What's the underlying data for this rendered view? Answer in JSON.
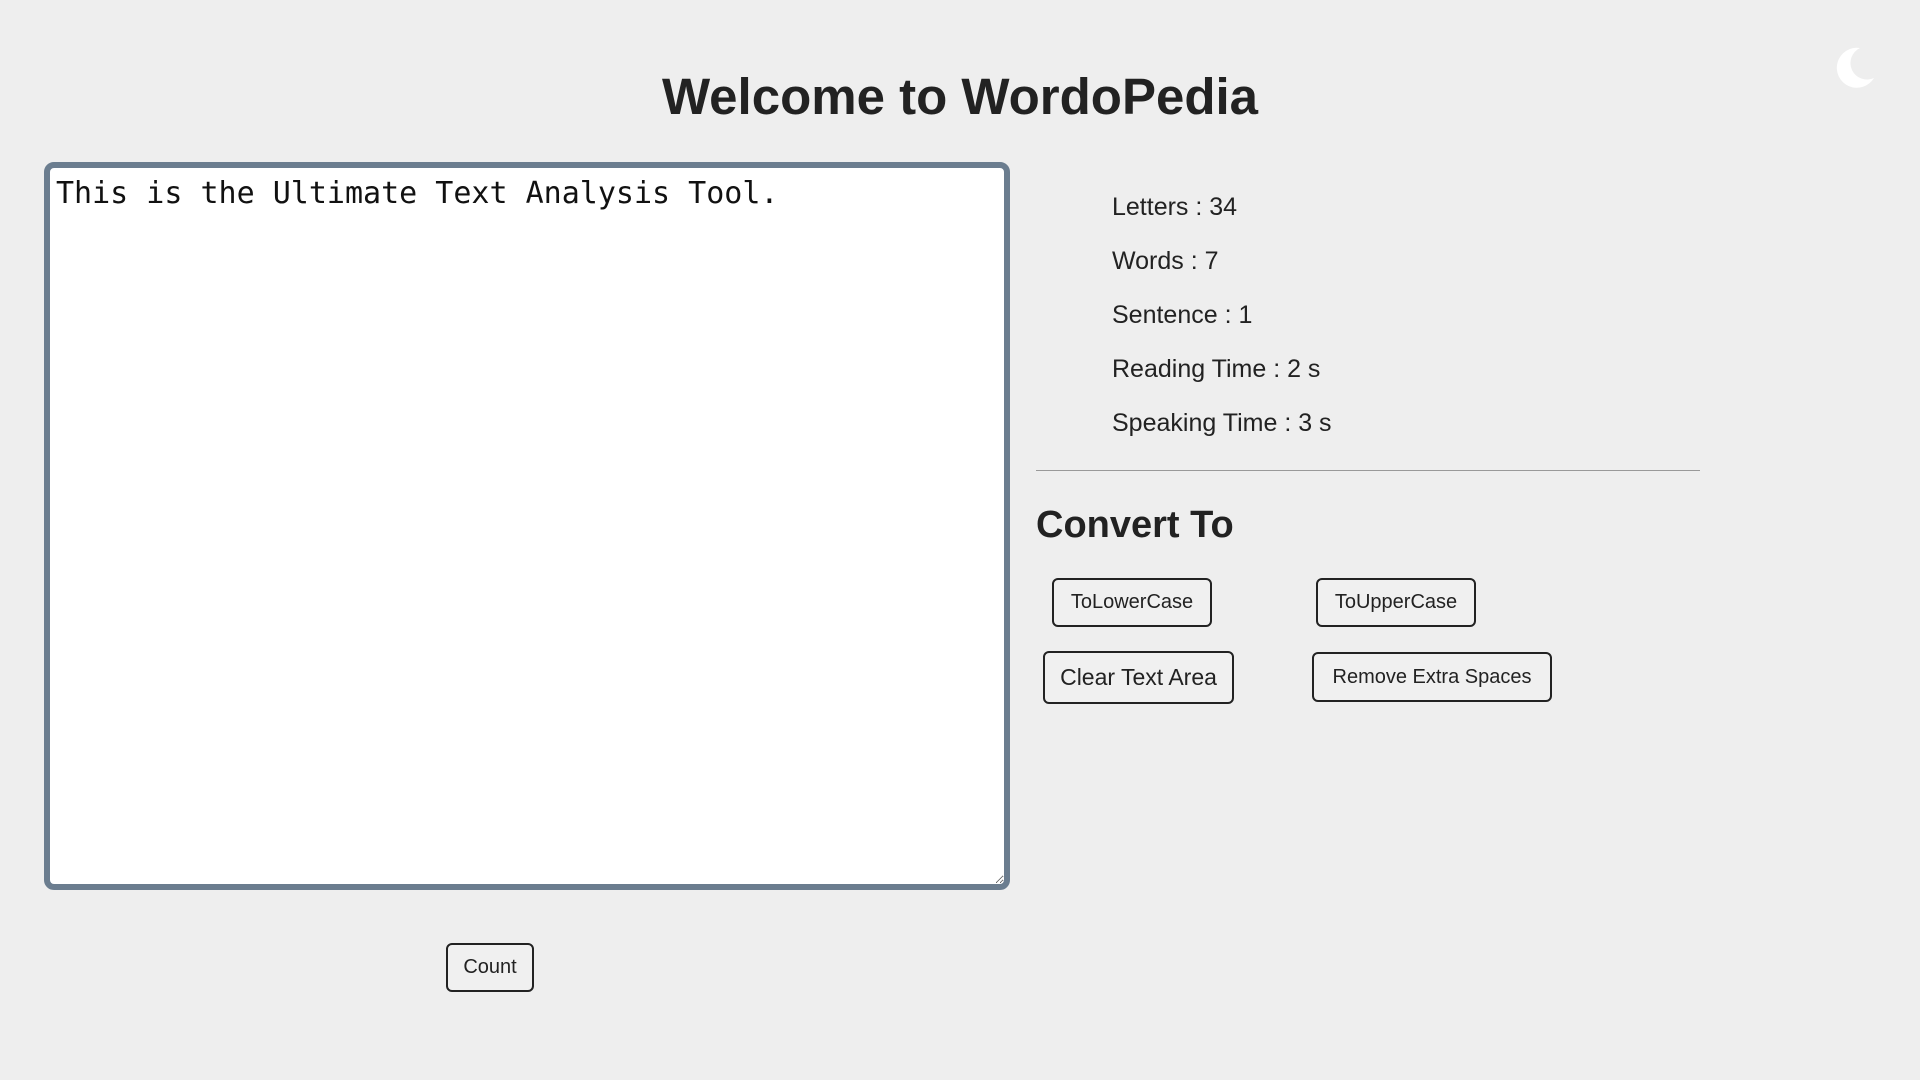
{
  "header": {
    "title": "Welcome to WordoPedia"
  },
  "theme_toggle": {
    "icon": "moon-icon",
    "color": "#ffffff"
  },
  "editor": {
    "value": "This is the Ultimate Text Analysis Tool."
  },
  "count_button": {
    "label": "Count"
  },
  "stats": {
    "letters": "Letters : 34",
    "words": "Words : 7",
    "sentence": "Sentence : 1",
    "reading_time": "Reading Time : 2 s",
    "speaking_time": "Speaking Time : 3 s"
  },
  "convert": {
    "title": "Convert To",
    "lower_label": "ToLowerCase",
    "upper_label": "ToUpperCase",
    "clear_label": "Clear Text Area",
    "spaces_label": "Remove Extra Spaces"
  },
  "colors": {
    "background": "#eeeeee",
    "editor_border": "#6b7d8f",
    "text": "#222222"
  }
}
